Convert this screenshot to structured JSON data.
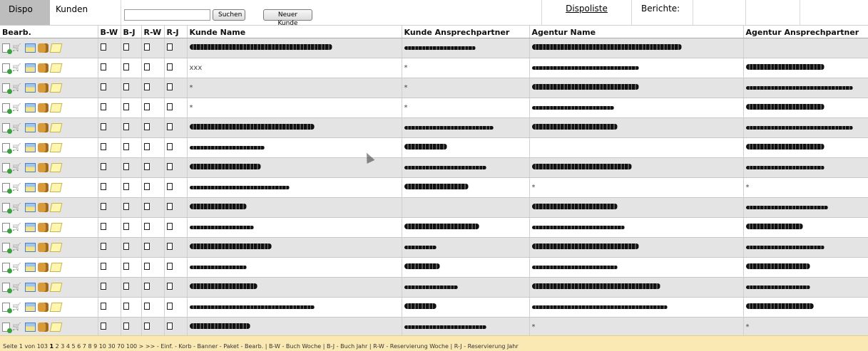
{
  "topbar": {
    "tab_dispo": "Dispo",
    "tab_kunden": "Kunden",
    "search_value": "",
    "search_button": "Suchen",
    "new_customer_button": "Neuer Kunde",
    "dispoliste_link": "Dispoliste",
    "berichte_label": "Berichte:"
  },
  "table": {
    "headers": {
      "bearb": "Bearb.",
      "bw": "B-W",
      "bj": "B-J",
      "rw": "R-W",
      "rj": "R-J",
      "kunde_name": "Kunde Name",
      "kunde_ap": "Kunde Ansprechpartner",
      "agentur_name": "Agentur Name",
      "agentur_ap": "Agentur Ansprechpartner"
    },
    "rows": [
      {
        "kunde_name": "",
        "kunde_ap": "",
        "agentur_name": "",
        "agentur_ap": ""
      },
      {
        "kunde_name": "xxx",
        "kunde_ap": "*",
        "agentur_name": "",
        "agentur_ap": ""
      },
      {
        "kunde_name": "*",
        "kunde_ap": "*",
        "agentur_name": "",
        "agentur_ap": ""
      },
      {
        "kunde_name": "*",
        "kunde_ap": "*",
        "agentur_name": "",
        "agentur_ap": ""
      },
      {
        "kunde_name": "",
        "kunde_ap": "",
        "agentur_name": "",
        "agentur_ap": ""
      },
      {
        "kunde_name": "",
        "kunde_ap": "",
        "agentur_name": "",
        "agentur_ap": ""
      },
      {
        "kunde_name": "",
        "kunde_ap": "",
        "agentur_name": "",
        "agentur_ap": ""
      },
      {
        "kunde_name": "",
        "kunde_ap": "",
        "agentur_name": "*",
        "agentur_ap": "*"
      },
      {
        "kunde_name": "",
        "kunde_ap": "",
        "agentur_name": "",
        "agentur_ap": ""
      },
      {
        "kunde_name": "",
        "kunde_ap": "",
        "agentur_name": "",
        "agentur_ap": ""
      },
      {
        "kunde_name": "",
        "kunde_ap": "",
        "agentur_name": "",
        "agentur_ap": ""
      },
      {
        "kunde_name": "",
        "kunde_ap": "",
        "agentur_name": "",
        "agentur_ap": ""
      },
      {
        "kunde_name": "",
        "kunde_ap": "",
        "agentur_name": "",
        "agentur_ap": ""
      },
      {
        "kunde_name": "",
        "kunde_ap": "",
        "agentur_name": "",
        "agentur_ap": ""
      },
      {
        "kunde_name": "",
        "kunde_ap": "",
        "agentur_name": "*",
        "agentur_ap": "*"
      }
    ],
    "row_icons": [
      "doc-add-icon",
      "cart-icon",
      "banner-icon",
      "package-icon",
      "edit-icon"
    ],
    "page_icon": "page-icon"
  },
  "footer": {
    "page_text": "Seite 1 von 103",
    "current_page": "1",
    "page_links": "2 3 4 5 6 7 8 9 10 30 70 100 > >>",
    "legend": "- Einf.   - Korb   - Banner   - Paket   - Bearb.  |  B-W - Buch Woche  |  B-J - Buch Jahr  |  R-W - Reservierung Woche  |  R-J - Reservierung Jahr"
  },
  "colors": {
    "header_tab_bg": "#bdbdbd",
    "row_alt_bg": "#e4e4e4",
    "footer_bg": "#fbe9b4"
  }
}
